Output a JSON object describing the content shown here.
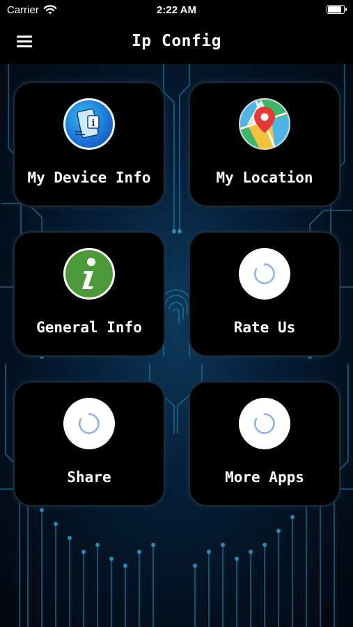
{
  "status_bar": {
    "carrier": "Carrier",
    "time": "2:22 AM",
    "wifi_icon": "wifi-icon",
    "battery_icon": "battery-icon"
  },
  "nav": {
    "title": "Ip Config",
    "menu_icon": "hamburger-menu-icon"
  },
  "tiles": [
    {
      "label": "My Device Info",
      "icon": "device-info-icon"
    },
    {
      "label": "My Location",
      "icon": "map-location-pin-icon"
    },
    {
      "label": "General Info",
      "icon": "info-icon"
    },
    {
      "label": "Rate Us",
      "icon": "loading-spinner-icon"
    },
    {
      "label": "Share",
      "icon": "loading-spinner-icon"
    },
    {
      "label": "More Apps",
      "icon": "loading-spinner-icon"
    }
  ],
  "colors": {
    "background": "#000000",
    "tile_background": "#000000",
    "circuit_accent": "#2a8fb8",
    "info_green": "#4c9a3a",
    "spinner_blue": "#8ab4e8"
  }
}
